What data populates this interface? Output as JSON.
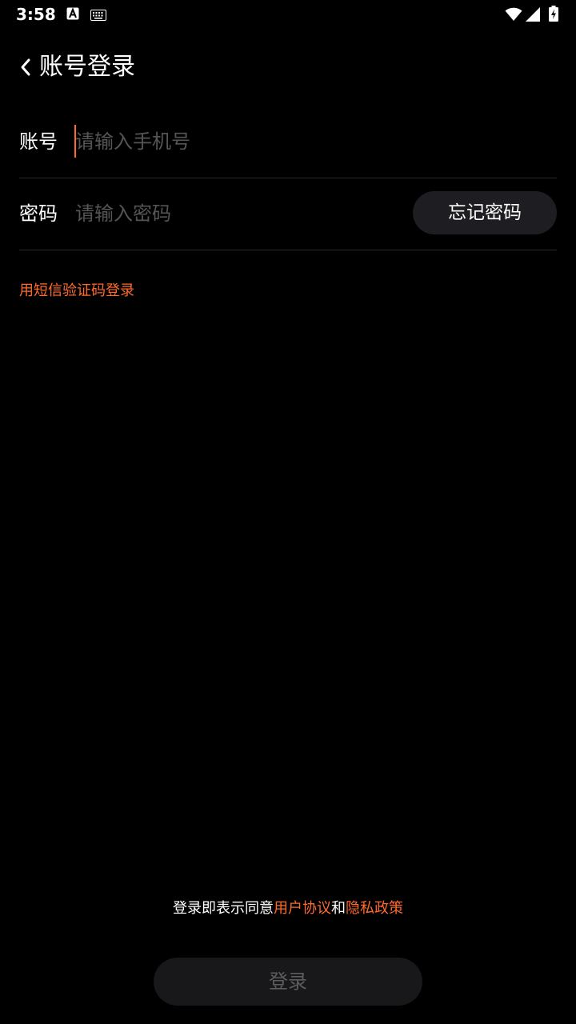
{
  "status_bar": {
    "time": "3:58",
    "icons": [
      "text-a-icon",
      "keyboard-icon",
      "wifi-icon",
      "signal-icon",
      "battery-charging-icon"
    ]
  },
  "header": {
    "back_icon": "chevron-left-icon",
    "title": "账号登录"
  },
  "form": {
    "account": {
      "label": "账号",
      "placeholder": "请输入手机号",
      "value": ""
    },
    "password": {
      "label": "密码",
      "placeholder": "请输入密码",
      "value": "",
      "forgot_label": "忘记密码"
    }
  },
  "sms_login_label": "用短信验证码登录",
  "agreement": {
    "prefix": "登录即表示同意",
    "user_agreement": "用户协议",
    "and": "和",
    "privacy_policy": "隐私政策"
  },
  "login_button": {
    "label": "登录"
  },
  "colors": {
    "background": "#000000",
    "accent": "#ff6a2b",
    "button_bg": "#1e1e22",
    "placeholder": "#555555",
    "divider": "#2a2a2a"
  }
}
